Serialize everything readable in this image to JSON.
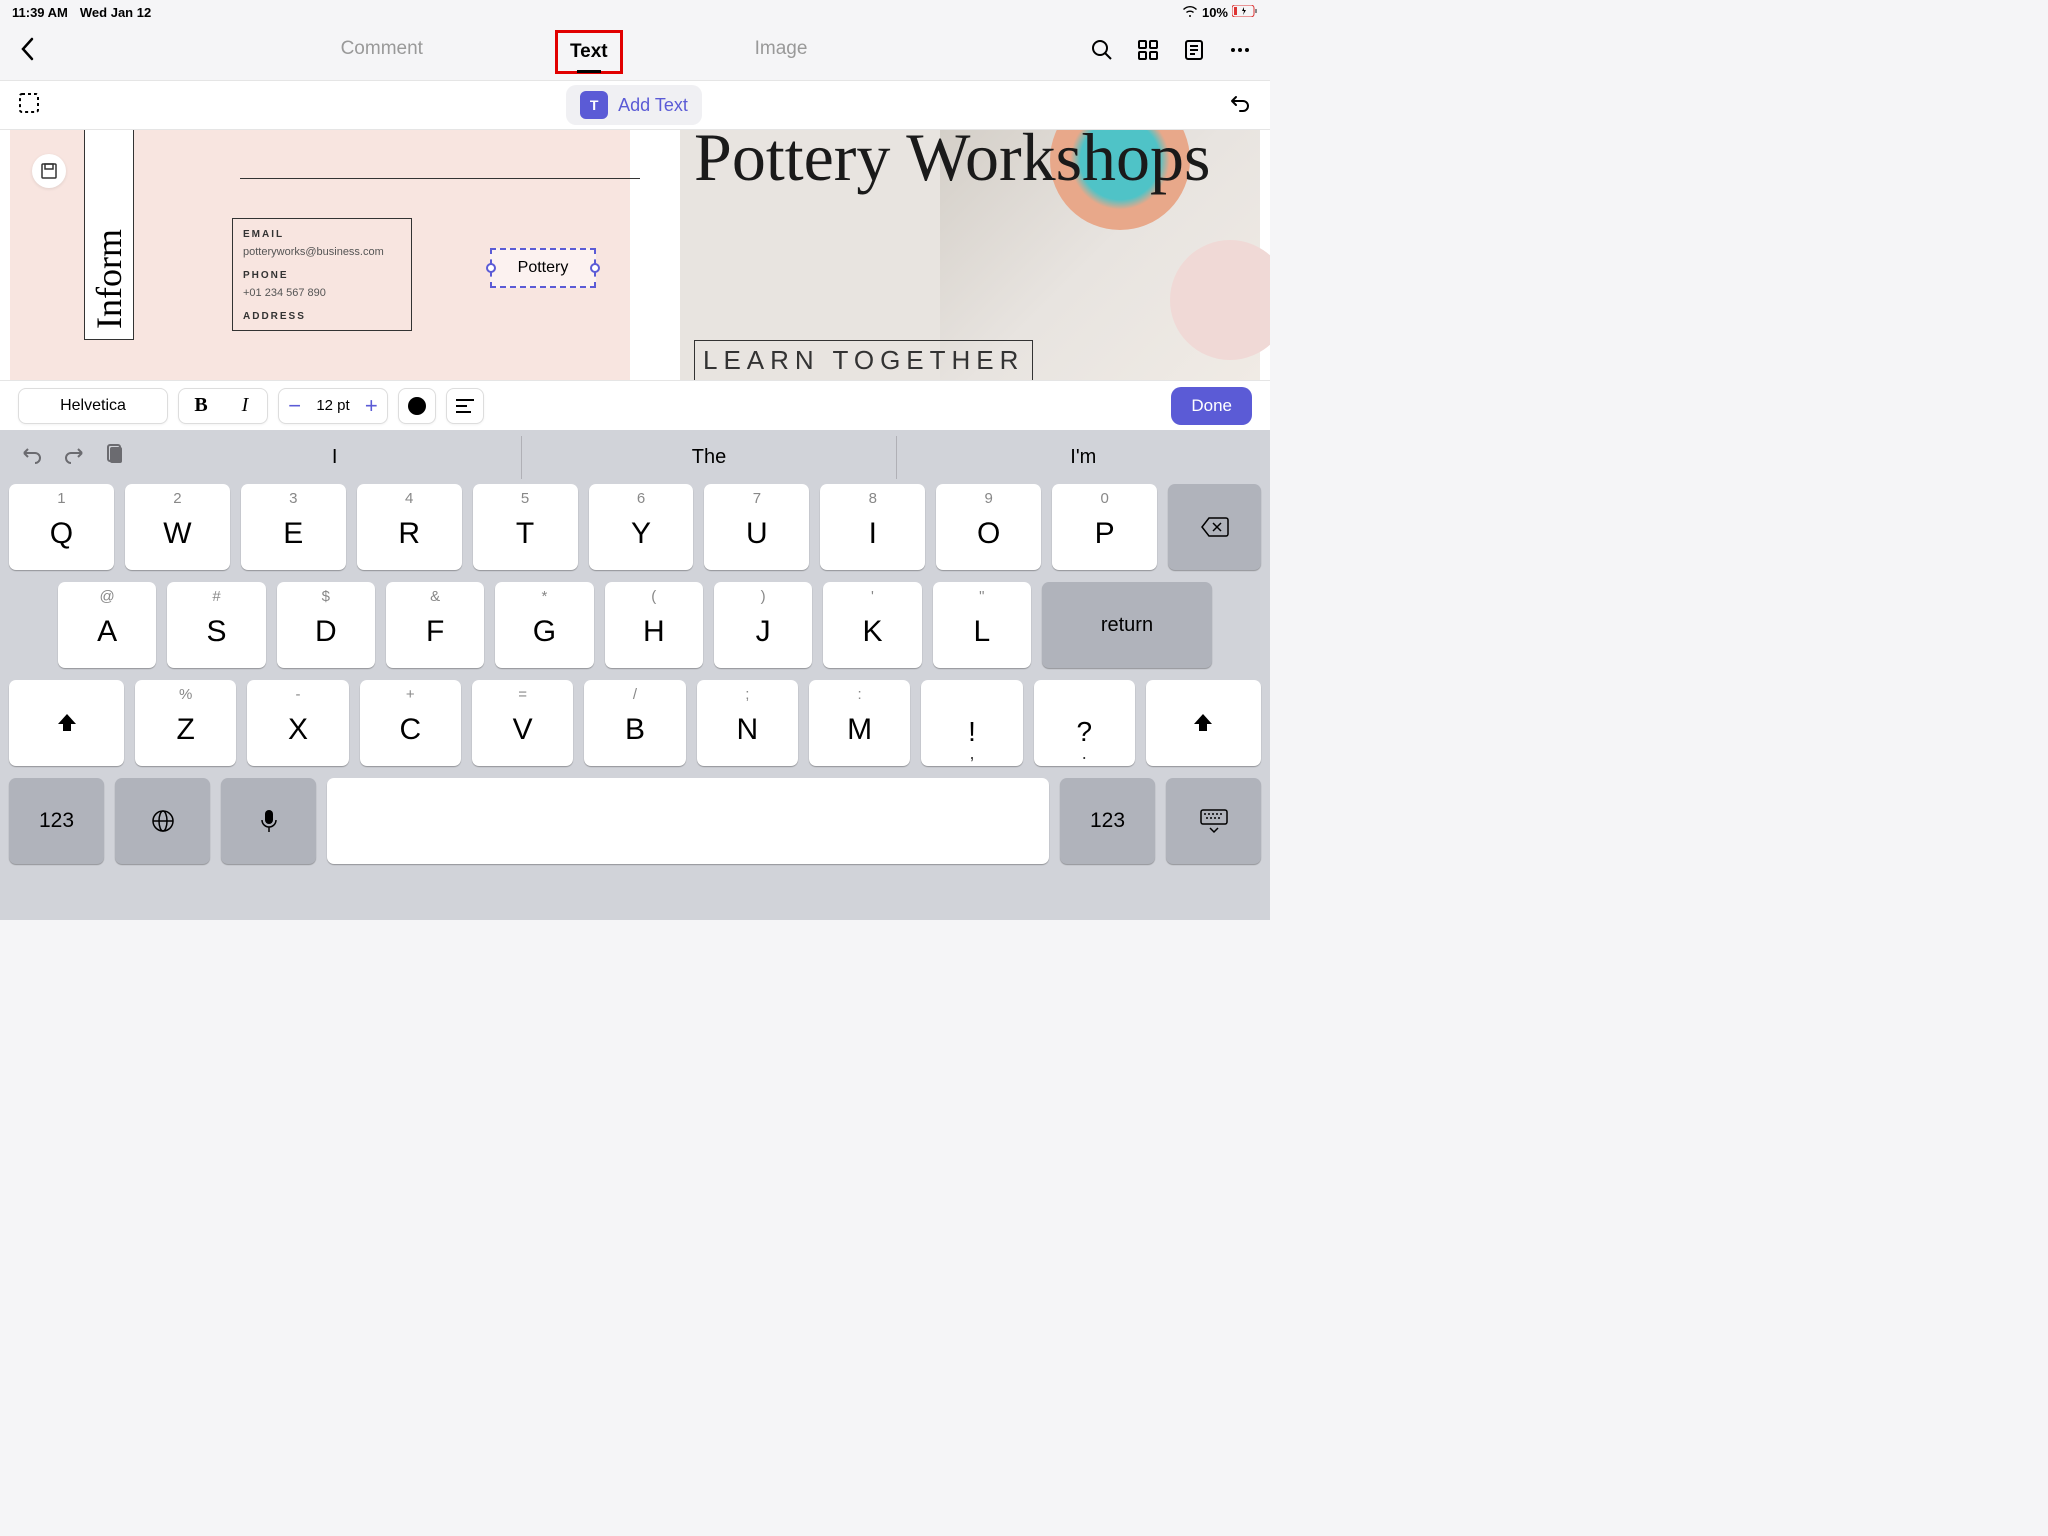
{
  "status": {
    "time": "11:39 AM",
    "date": "Wed Jan 12",
    "battery": "10%"
  },
  "nav": {
    "back": "‹",
    "tabs": {
      "comment": "Comment",
      "text": "Text",
      "image": "Image"
    }
  },
  "toolbar": {
    "add_text": "Add Text"
  },
  "canvas": {
    "page1": {
      "vertical": "Inform",
      "email_label": "EMAIL",
      "email": "potteryworks@business.com",
      "phone_label": "PHONE",
      "phone": "+01 234 567 890",
      "address_label": "ADDRESS",
      "textbox": "Pottery"
    },
    "page2": {
      "title": "Pottery Workshops",
      "subtitle": "LEARN TOGETHER"
    }
  },
  "format": {
    "font": "Helvetica",
    "size": "12 pt",
    "done": "Done"
  },
  "keyboard": {
    "suggestions": [
      "I",
      "The",
      "I'm"
    ],
    "row1": [
      {
        "a": "1",
        "m": "Q"
      },
      {
        "a": "2",
        "m": "W"
      },
      {
        "a": "3",
        "m": "E"
      },
      {
        "a": "4",
        "m": "R"
      },
      {
        "a": "5",
        "m": "T"
      },
      {
        "a": "6",
        "m": "Y"
      },
      {
        "a": "7",
        "m": "U"
      },
      {
        "a": "8",
        "m": "I"
      },
      {
        "a": "9",
        "m": "O"
      },
      {
        "a": "0",
        "m": "P"
      }
    ],
    "row2": [
      {
        "a": "@",
        "m": "A"
      },
      {
        "a": "#",
        "m": "S"
      },
      {
        "a": "$",
        "m": "D"
      },
      {
        "a": "&",
        "m": "F"
      },
      {
        "a": "*",
        "m": "G"
      },
      {
        "a": "(",
        "m": "H"
      },
      {
        "a": ")",
        "m": "J"
      },
      {
        "a": "'",
        "m": "K"
      },
      {
        "a": "\"",
        "m": "L"
      }
    ],
    "return": "return",
    "row3": [
      {
        "a": "%",
        "m": "Z"
      },
      {
        "a": "-",
        "m": "X"
      },
      {
        "a": "+",
        "m": "C"
      },
      {
        "a": "=",
        "m": "V"
      },
      {
        "a": "/",
        "m": "B"
      },
      {
        "a": ";",
        "m": "N"
      },
      {
        "a": ":",
        "m": "M"
      },
      {
        "a": "!",
        "m": ","
      },
      {
        "a": "?",
        "m": "."
      }
    ],
    "mode": "123"
  }
}
